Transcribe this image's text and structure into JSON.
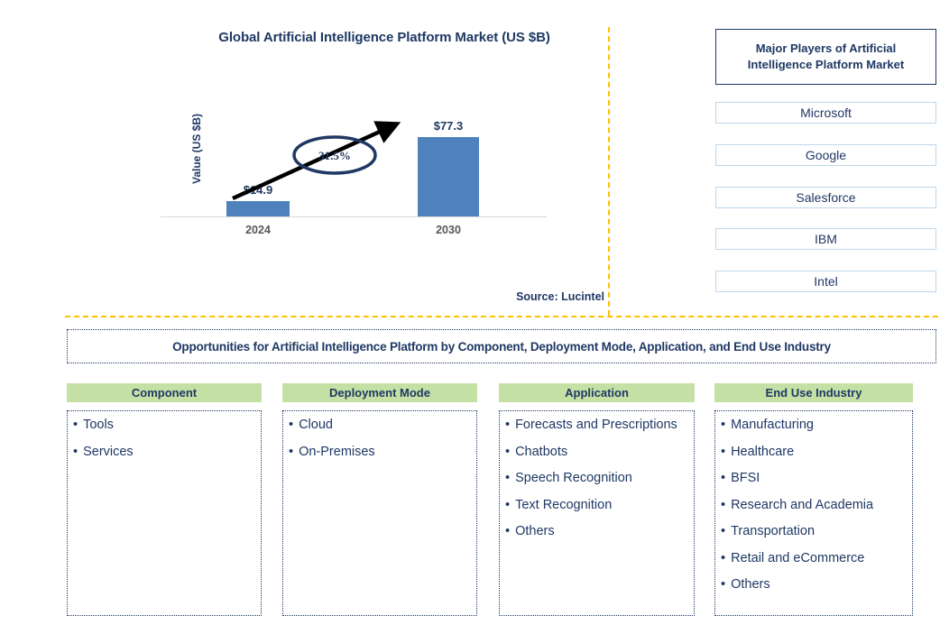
{
  "chart_data": {
    "type": "bar",
    "title": "Global Artificial Intelligence Platform Market (US $B)",
    "categories": [
      "2024",
      "2030"
    ],
    "values": [
      14.9,
      77.3
    ],
    "value_labels": [
      "$14.9",
      "$77.3"
    ],
    "xlabel": "",
    "ylabel": "Value (US $B)",
    "ylim": [
      0,
      85
    ],
    "grid": false,
    "legend": "none",
    "annotation": "31.5%",
    "annotation_kind": "CAGR growth arrow",
    "bar_color": "#4f81bd",
    "source": "Source: Lucintel"
  },
  "chart": {
    "title": "Global Artificial Intelligence Platform Market (US $B)",
    "y_axis_label": "Value (US $B)",
    "cagr": "31.5%",
    "bars": [
      {
        "label": "2024",
        "value_label": "$14.9"
      },
      {
        "label": "2030",
        "value_label": "$77.3"
      }
    ],
    "source": "Source: Lucintel"
  },
  "players_panel": {
    "title": "Major Players of Artificial Intelligence Platform Market",
    "items": [
      {
        "name": "Microsoft"
      },
      {
        "name": "Google"
      },
      {
        "name": "Salesforce"
      },
      {
        "name": "IBM"
      },
      {
        "name": "Intel"
      }
    ]
  },
  "opportunities": {
    "banner": "Opportunities for Artificial Intelligence Platform by Component, Deployment Mode, Application, and End Use Industry",
    "columns": [
      {
        "header": "Component",
        "items": [
          "Tools",
          "Services"
        ]
      },
      {
        "header": "Deployment Mode",
        "items": [
          "Cloud",
          "On-Premises"
        ]
      },
      {
        "header": "Application",
        "items": [
          "Forecasts and Prescriptions",
          "Chatbots",
          "Speech Recognition",
          "Text Recognition",
          "Others"
        ]
      },
      {
        "header": "End Use Industry",
        "items": [
          "Manufacturing",
          "Healthcare",
          "BFSI",
          "Research and Academia",
          "Transportation",
          "Retail and eCommerce",
          "Others"
        ]
      }
    ]
  },
  "colors": {
    "navy": "#1f3864",
    "bar_blue": "#4f81bd",
    "header_green": "#c5e0a5",
    "divider_orange": "#ffc000",
    "box_border_light": "#bdd7ee"
  }
}
